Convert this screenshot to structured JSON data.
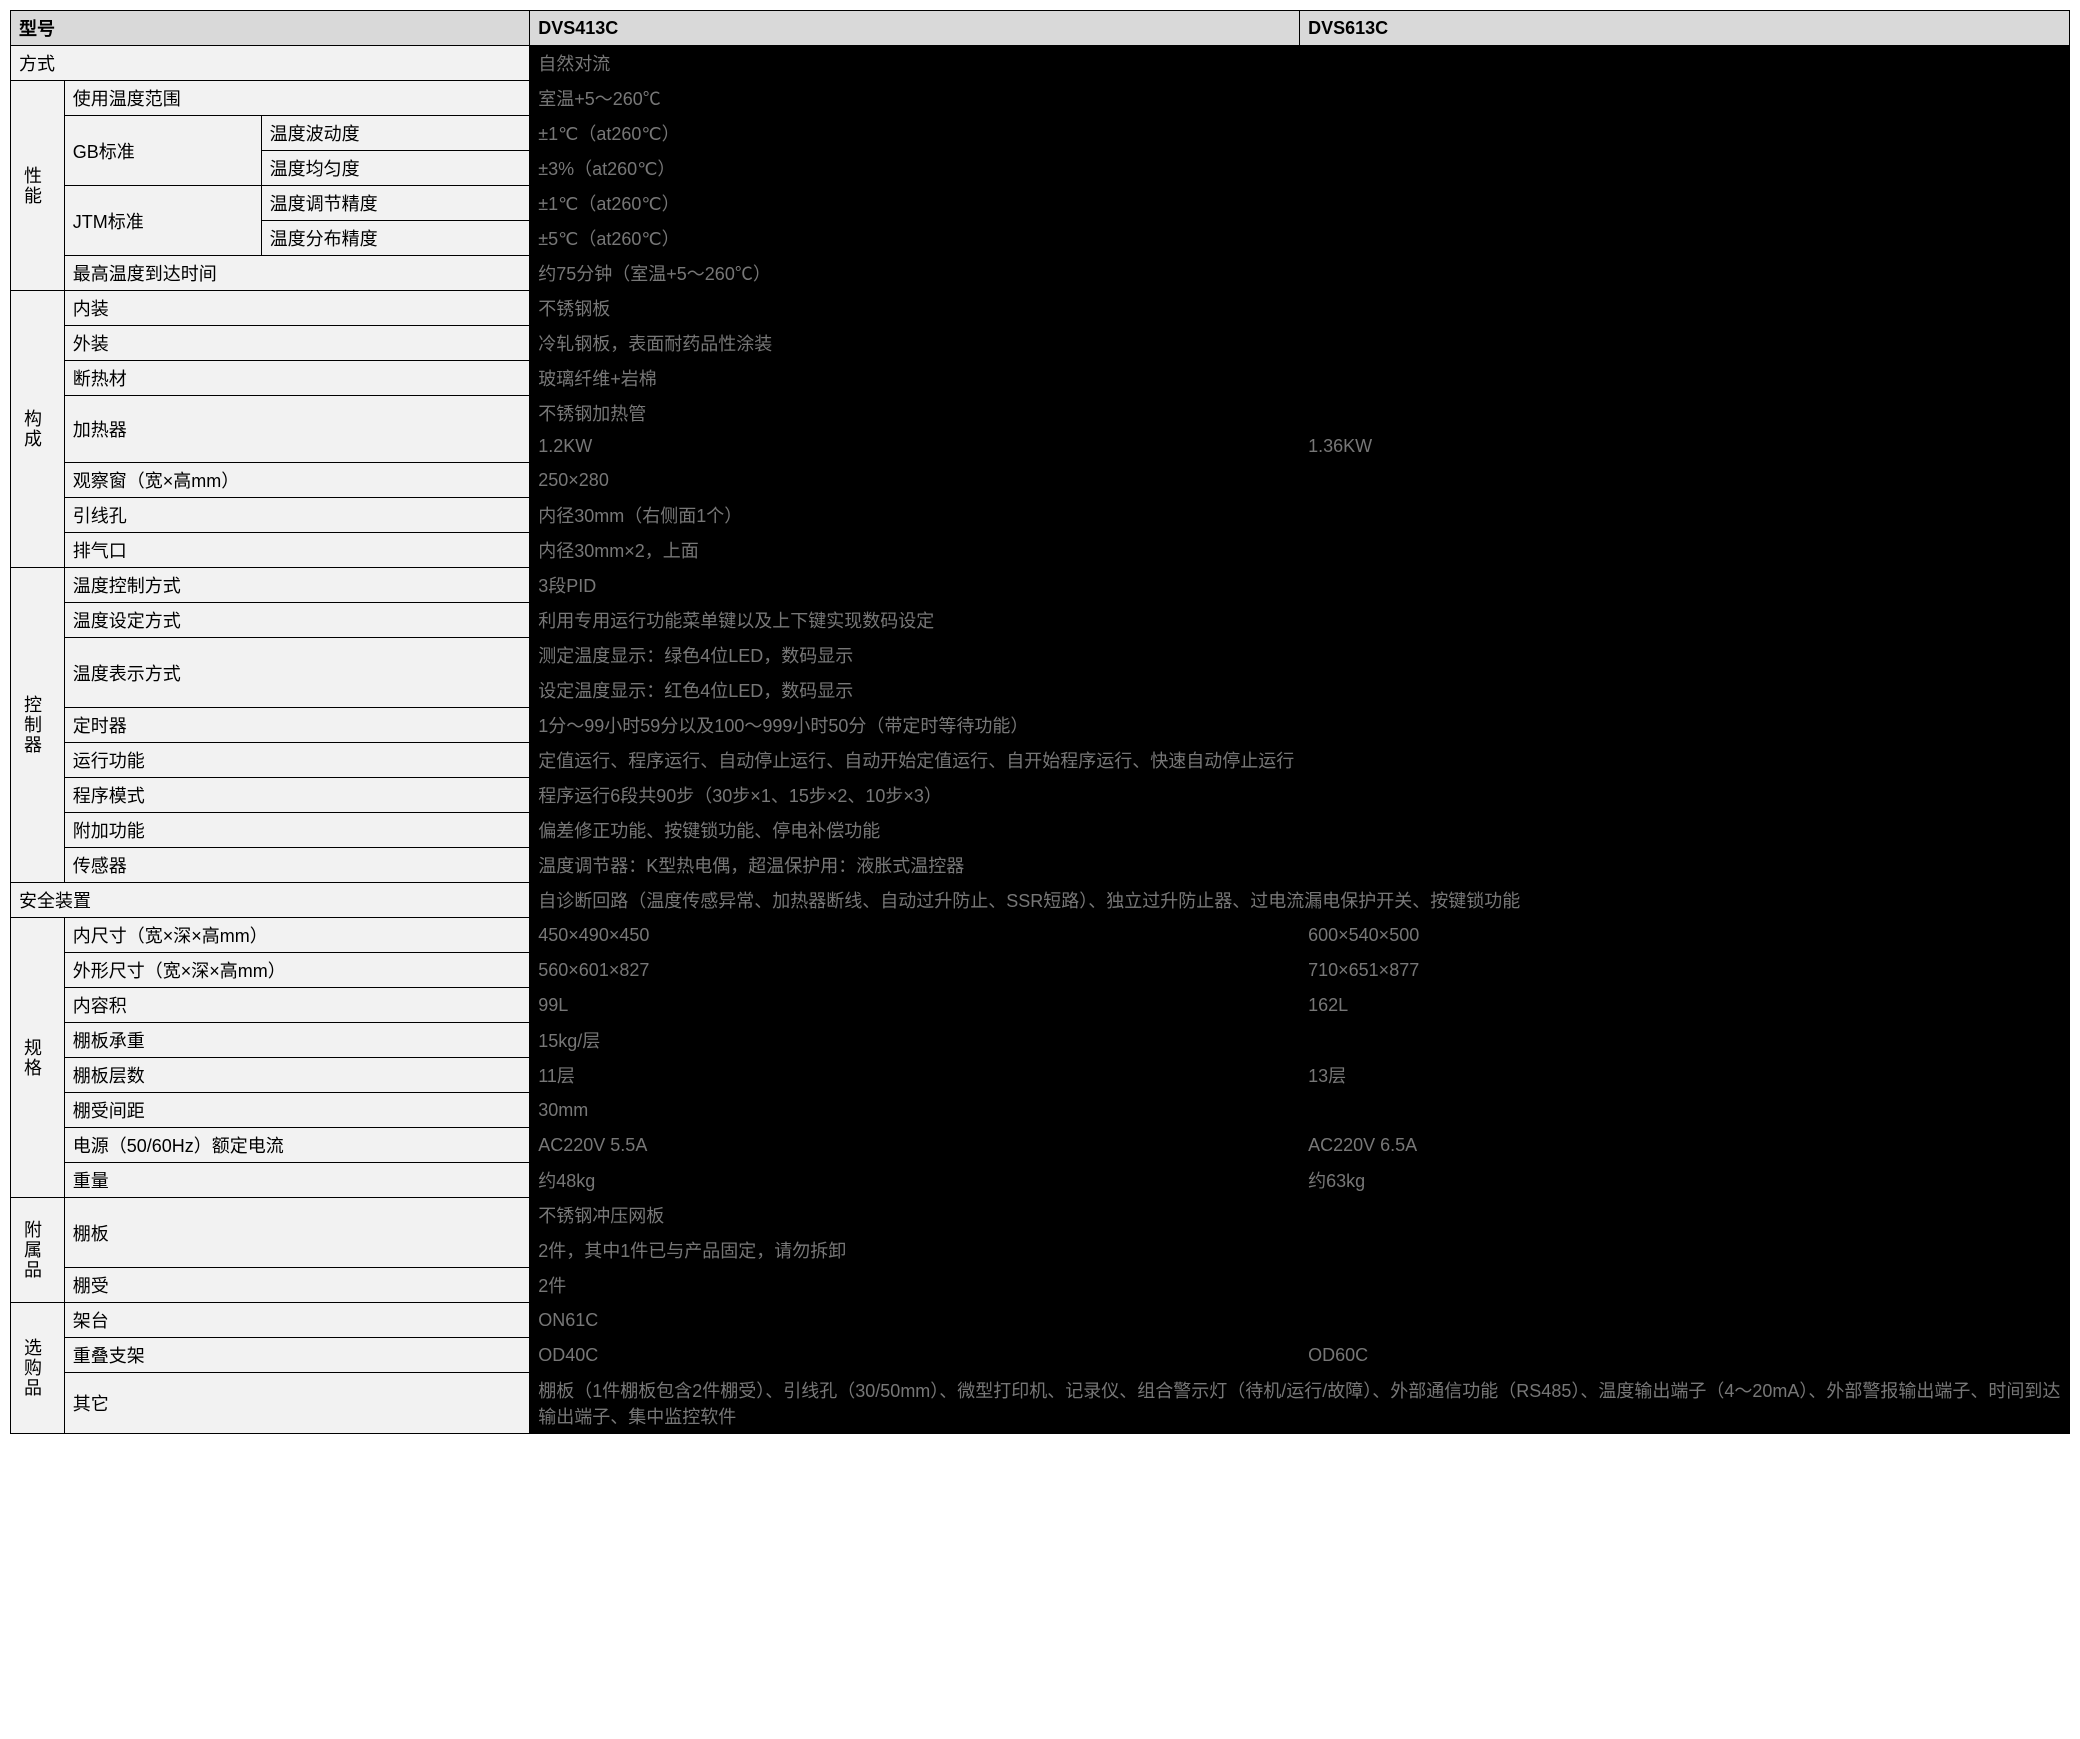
{
  "header": {
    "model": "型号",
    "col1": "DVS413C",
    "col2": "DVS613C"
  },
  "method": {
    "label": "方式",
    "value": "自然对流"
  },
  "perf": {
    "group": "性能",
    "tempRange": {
      "label": "使用温度范围",
      "value": "室温+5～260℃"
    },
    "gb": {
      "label": "GB标准",
      "fluct": {
        "label": "温度波动度",
        "value": "±1℃（at260℃）"
      },
      "unif": {
        "label": "温度均匀度",
        "value": "±3%（at260℃）"
      }
    },
    "jtm": {
      "label": "JTM标准",
      "adj": {
        "label": "温度调节精度",
        "value": "±1℃（at260℃）"
      },
      "dist": {
        "label": "温度分布精度",
        "value": "±5℃（at260℃）"
      }
    },
    "maxTime": {
      "label": "最高温度到达时间",
      "value": "约75分钟（室温+5～260℃）"
    }
  },
  "struct": {
    "group": "构成",
    "inner": {
      "label": "内装",
      "value": "不锈钢板"
    },
    "outer": {
      "label": "外装",
      "value": "冷轧钢板，表面耐药品性涂装"
    },
    "insul": {
      "label": "断热材",
      "value": "玻璃纤维+岩棉"
    },
    "heater": {
      "label": "加热器",
      "v1": "不锈钢加热管",
      "v2a": "1.2KW",
      "v2b": "1.36KW"
    },
    "window": {
      "label": "观察窗（宽×高mm）",
      "value": "250×280"
    },
    "leadhole": {
      "label": "引线孔",
      "value": "内径30mm（右侧面1个）"
    },
    "exhaust": {
      "label": "排气口",
      "value": "内径30mm×2，上面"
    }
  },
  "ctrl": {
    "group": "控制器",
    "method": {
      "label": "温度控制方式",
      "value": "3段PID"
    },
    "set": {
      "label": "温度设定方式",
      "value": "利用专用运行功能菜单键以及上下键实现数码设定"
    },
    "disp": {
      "label": "温度表示方式",
      "v1": "测定温度显示：绿色4位LED，数码显示",
      "v2": "设定温度显示：红色4位LED，数码显示"
    },
    "timer": {
      "label": "定时器",
      "value": "1分～99小时59分以及100～999小时50分（带定时等待功能）"
    },
    "run": {
      "label": "运行功能",
      "value": "定值运行、程序运行、自动停止运行、自动开始定值运行、自开始程序运行、快速自动停止运行"
    },
    "prog": {
      "label": "程序模式",
      "value": "程序运行6段共90步（30步×1、15步×2、10步×3）"
    },
    "add": {
      "label": "附加功能",
      "value": "偏差修正功能、按键锁功能、停电补偿功能"
    },
    "sensor": {
      "label": "传感器",
      "value": "温度调节器：K型热电偶，超温保护用：液胀式温控器"
    }
  },
  "safety": {
    "label": "安全装置",
    "value": "自诊断回路（温度传感异常、加热器断线、自动过升防止、SSR短路）、独立过升防止器、过电流漏电保护开关、按键锁功能"
  },
  "spec": {
    "group": "规格",
    "inSize": {
      "label": "内尺寸（宽×深×高mm）",
      "a": "450×490×450",
      "b": "600×540×500"
    },
    "outSize": {
      "label": "外形尺寸（宽×深×高mm）",
      "a": "560×601×827",
      "b": "710×651×877"
    },
    "vol": {
      "label": "内容积",
      "a": "99L",
      "b": "162L"
    },
    "shelfW": {
      "label": "棚板承重",
      "value": "15kg/层"
    },
    "shelfN": {
      "label": "棚板层数",
      "a": "11层",
      "b": "13层"
    },
    "shelfD": {
      "label": "棚受间距",
      "value": "30mm"
    },
    "power": {
      "label": "电源（50/60Hz）额定电流",
      "a": "AC220V 5.5A",
      "b": "AC220V 6.5A"
    },
    "weight": {
      "label": "重量",
      "a": "约48kg",
      "b": "约63kg"
    }
  },
  "acc": {
    "group": "附属品",
    "shelf": {
      "label": "棚板",
      "v1": "不锈钢冲压网板",
      "v2": "2件，其中1件已与产品固定，请勿拆卸"
    },
    "rec": {
      "label": "棚受",
      "value": "2件"
    }
  },
  "opt": {
    "group": "选购品",
    "stand": {
      "label": "架台",
      "value": "ON61C"
    },
    "stack": {
      "label": "重叠支架",
      "a": "OD40C",
      "b": "OD60C"
    },
    "other": {
      "label": "其它",
      "value": "棚板（1件棚板包含2件棚受）、引线孔（30/50mm）、微型打印机、记录仪、组合警示灯（待机/运行/故障）、外部通信功能（RS485）、温度输出端子（4～20mA）、外部警报输出端子、时间到达输出端子、集中监控软件"
    }
  }
}
